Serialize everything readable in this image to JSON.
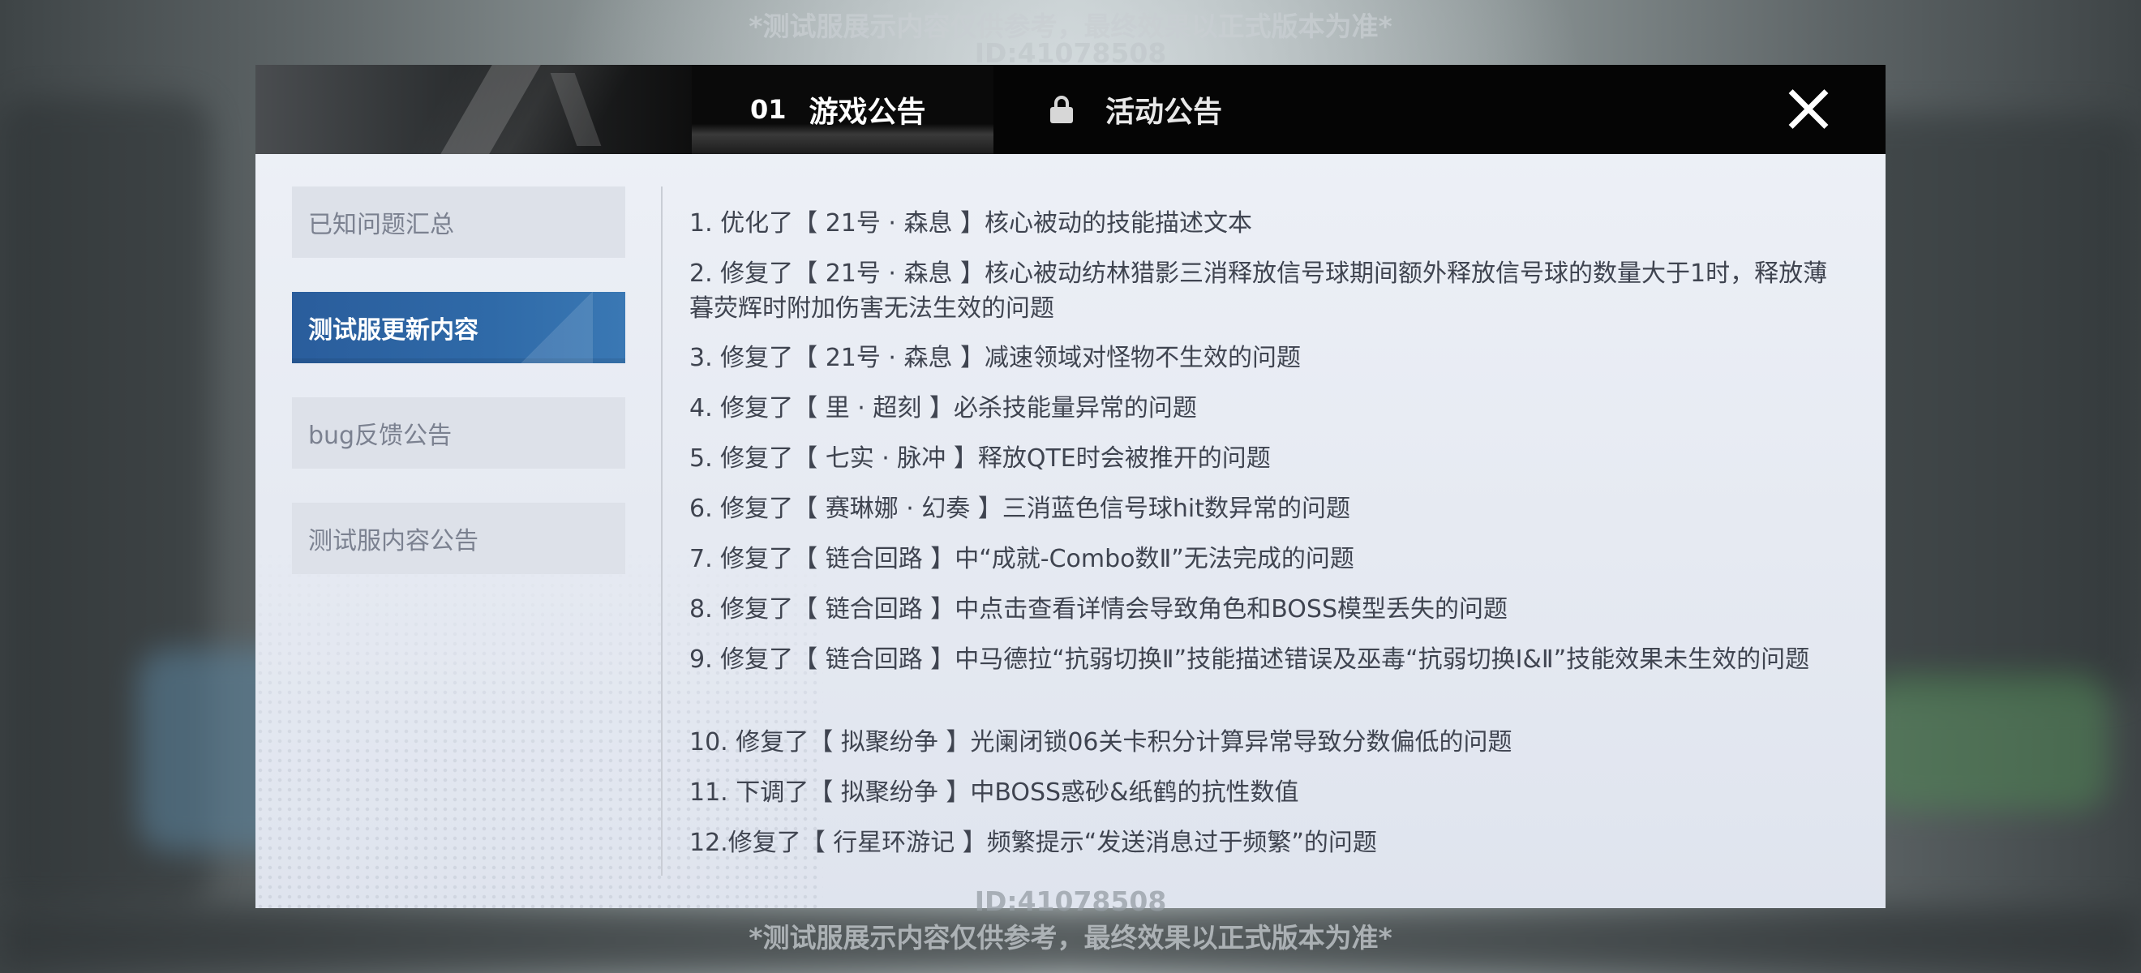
{
  "watermark": {
    "note": "*测试服展示内容仅供参考，最终效果以正式版本为准*",
    "id": "ID:41078508"
  },
  "tabs": [
    {
      "number": "01",
      "label": "游戏公告",
      "active": true
    },
    {
      "label": "活动公告",
      "locked": true,
      "icon": "lock-icon"
    }
  ],
  "close_icon": "close-icon",
  "sidebar": {
    "items": [
      {
        "label": "已知问题汇总",
        "active": false
      },
      {
        "label": "测试服更新内容",
        "active": true
      },
      {
        "label": "bug反馈公告",
        "active": false
      },
      {
        "label": "测试服内容公告",
        "active": false
      }
    ]
  },
  "content": {
    "notes": [
      "1. 优化了【 21号 · 森息 】核心被动的技能描述文本",
      " 2. 修复了【 21号 · 森息 】核心被动纺林猎影三消释放信号球期间额外释放信号球的数量大于1时，释放薄暮荧辉时附加伤害无法生效的问题",
      " 3. 修复了【 21号 · 森息 】减速领域对怪物不生效的问题",
      " 4. 修复了【 里 · 超刻 】必杀技能量异常的问题",
      "5. 修复了【 七实 · 脉冲 】释放QTE时会被推开的问题",
      " 6. 修复了【 赛琳娜 · 幻奏 】三消蓝色信号球hit数异常的问题",
      "7. 修复了【 链合回路 】中“成就-Combo数Ⅱ”无法完成的问题",
      " 8. 修复了【 链合回路 】中点击查看详情会导致角色和BOSS模型丢失的问题",
      " 9. 修复了【 链合回路 】中马德拉“抗弱切换Ⅱ”技能描述错误及巫毒“抗弱切换Ⅰ&Ⅱ”技能效果未生效的问题",
      "10. 修复了【 拟聚纷争 】光阑闭锁06关卡积分计算异常导致分数偏低的问题",
      "11. 下调了【 拟聚纷争 】中BOSS惑砂&纸鹤的抗性数值",
      " 12.修复了【 行星环游记 】频繁提示“发送消息过于频繁”的问题"
    ]
  }
}
